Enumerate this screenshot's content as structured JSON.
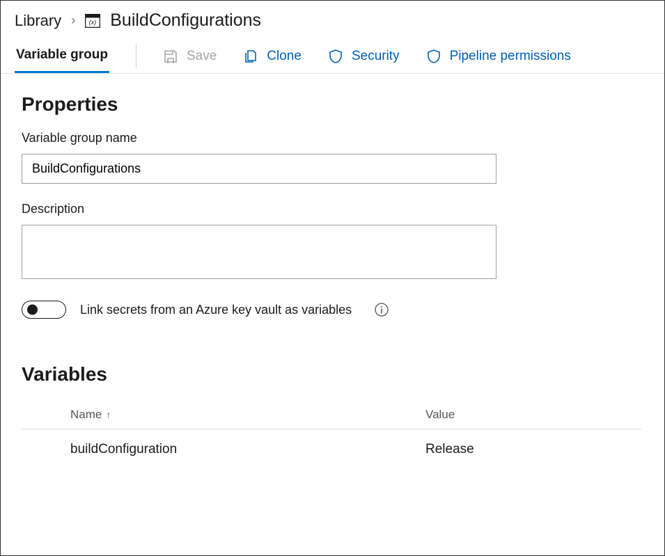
{
  "breadcrumb": {
    "root": "Library",
    "title": "BuildConfigurations"
  },
  "toolbar": {
    "tab": "Variable group",
    "save": "Save",
    "clone": "Clone",
    "security": "Security",
    "pipePerm": "Pipeline permissions"
  },
  "properties": {
    "heading": "Properties",
    "nameLabel": "Variable group name",
    "nameValue": "BuildConfigurations",
    "descLabel": "Description",
    "descValue": "",
    "linkLabel": "Link secrets from an Azure key vault as variables"
  },
  "variables": {
    "heading": "Variables",
    "columns": {
      "name": "Name",
      "value": "Value"
    },
    "rows": [
      {
        "name": "buildConfiguration",
        "value": "Release"
      }
    ]
  }
}
